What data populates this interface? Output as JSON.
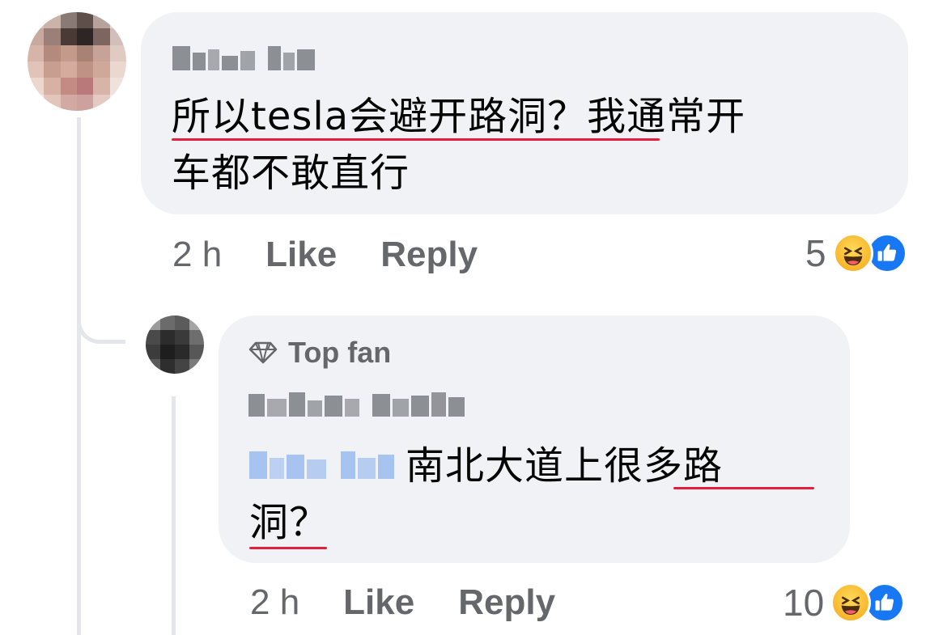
{
  "colors": {
    "bubble_bg": "#f0f2f5",
    "meta_text": "#65676b",
    "thread_line": "#e4e6eb",
    "spell_underline": "#e41e3f",
    "like_blue": "#1877f2",
    "haha_yellow": "#f7b125"
  },
  "comment": {
    "author_name_blurred": true,
    "text_line1": "所以tesla会避开路洞？我通常开",
    "text_line2": "车都不敢直行",
    "time": "2 h",
    "like_label": "Like",
    "reply_label": "Reply",
    "reaction_count": "5",
    "reaction_icons": [
      "haha-icon",
      "like-icon"
    ]
  },
  "reply": {
    "badge": "Top fan",
    "badge_icon": "diamond-icon",
    "author_name_blurred": true,
    "mention_blurred": true,
    "text_line1": "南北大道上很多路",
    "text_line2": "洞？",
    "time": "2 h",
    "like_label": "Like",
    "reply_label": "Reply",
    "reaction_count": "10",
    "reaction_icons": [
      "haha-icon",
      "like-icon"
    ]
  }
}
